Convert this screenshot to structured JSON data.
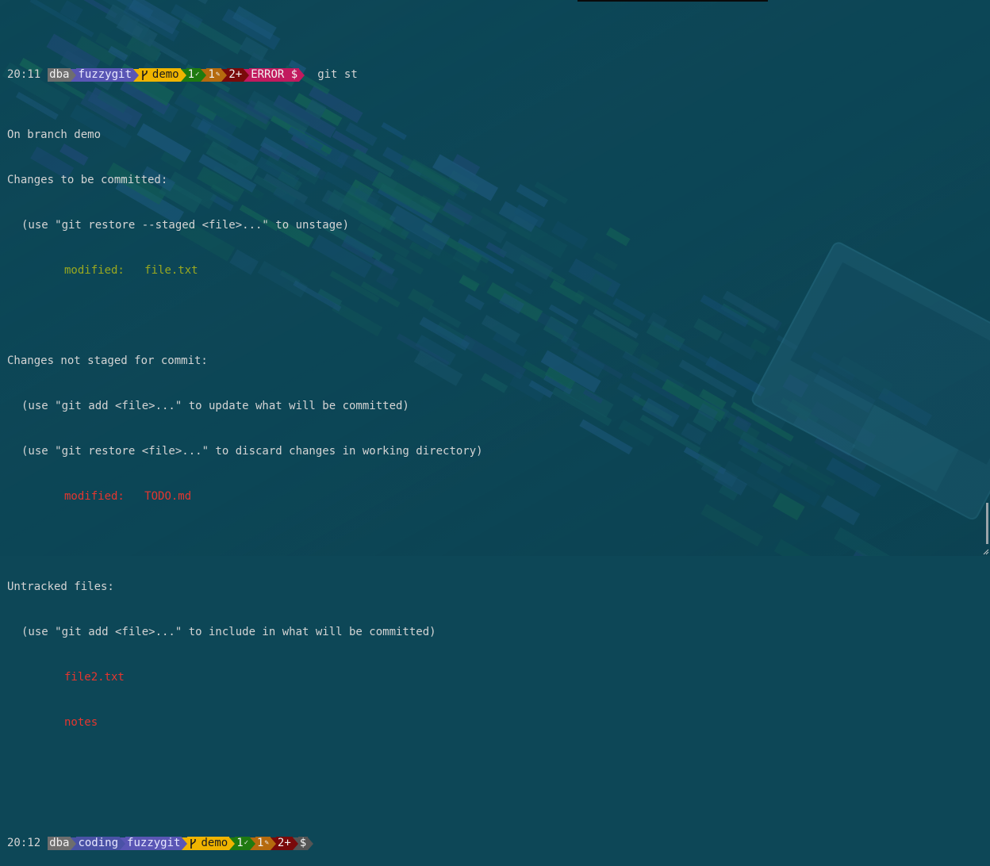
{
  "prompt1": {
    "time": "20:11",
    "user": "dba",
    "repo": "fuzzygit",
    "branch": "demo",
    "staged": "1",
    "modified": "1",
    "untracked": "2+",
    "error": "ERROR $",
    "command": "git st"
  },
  "output": {
    "line1": "On branch demo",
    "staged_header": "Changes to be committed:",
    "staged_hint": "(use \"git restore --staged <file>...\" to unstage)",
    "staged_label": "modified:",
    "staged_file": "file.txt",
    "unstaged_header": "Changes not staged for commit:",
    "unstaged_hint1": "(use \"git add <file>...\" to update what will be committed)",
    "unstaged_hint2": "(use \"git restore <file>...\" to discard changes in working directory)",
    "unstaged_label": "modified:",
    "unstaged_file": "TODO.md",
    "untracked_header": "Untracked files:",
    "untracked_hint": "(use \"git add <file>...\" to include in what will be committed)",
    "untracked_files": [
      "file2.txt",
      "notes"
    ]
  },
  "prompt2": {
    "time": "20:12",
    "user": "dba",
    "folder": "coding",
    "repo": "fuzzygit",
    "branch": "demo",
    "staged": "1",
    "modified": "1",
    "untracked": "2+",
    "dollar": "$"
  },
  "colors": {
    "background": "#0d4757",
    "staged_text": "#9aa81f",
    "unstaged_text": "#e5362f",
    "segment_user": "#6e6e6e",
    "segment_repo": "#5a56b5",
    "segment_branch": "#f0b400",
    "segment_staged": "#1f7a10",
    "segment_modified": "#b56a0e",
    "segment_untracked": "#7a0a0a",
    "segment_error": "#c21a5e"
  },
  "icons": {
    "branch": "git-branch-icon",
    "staged": "check-icon",
    "modified": "pencil-icon"
  }
}
